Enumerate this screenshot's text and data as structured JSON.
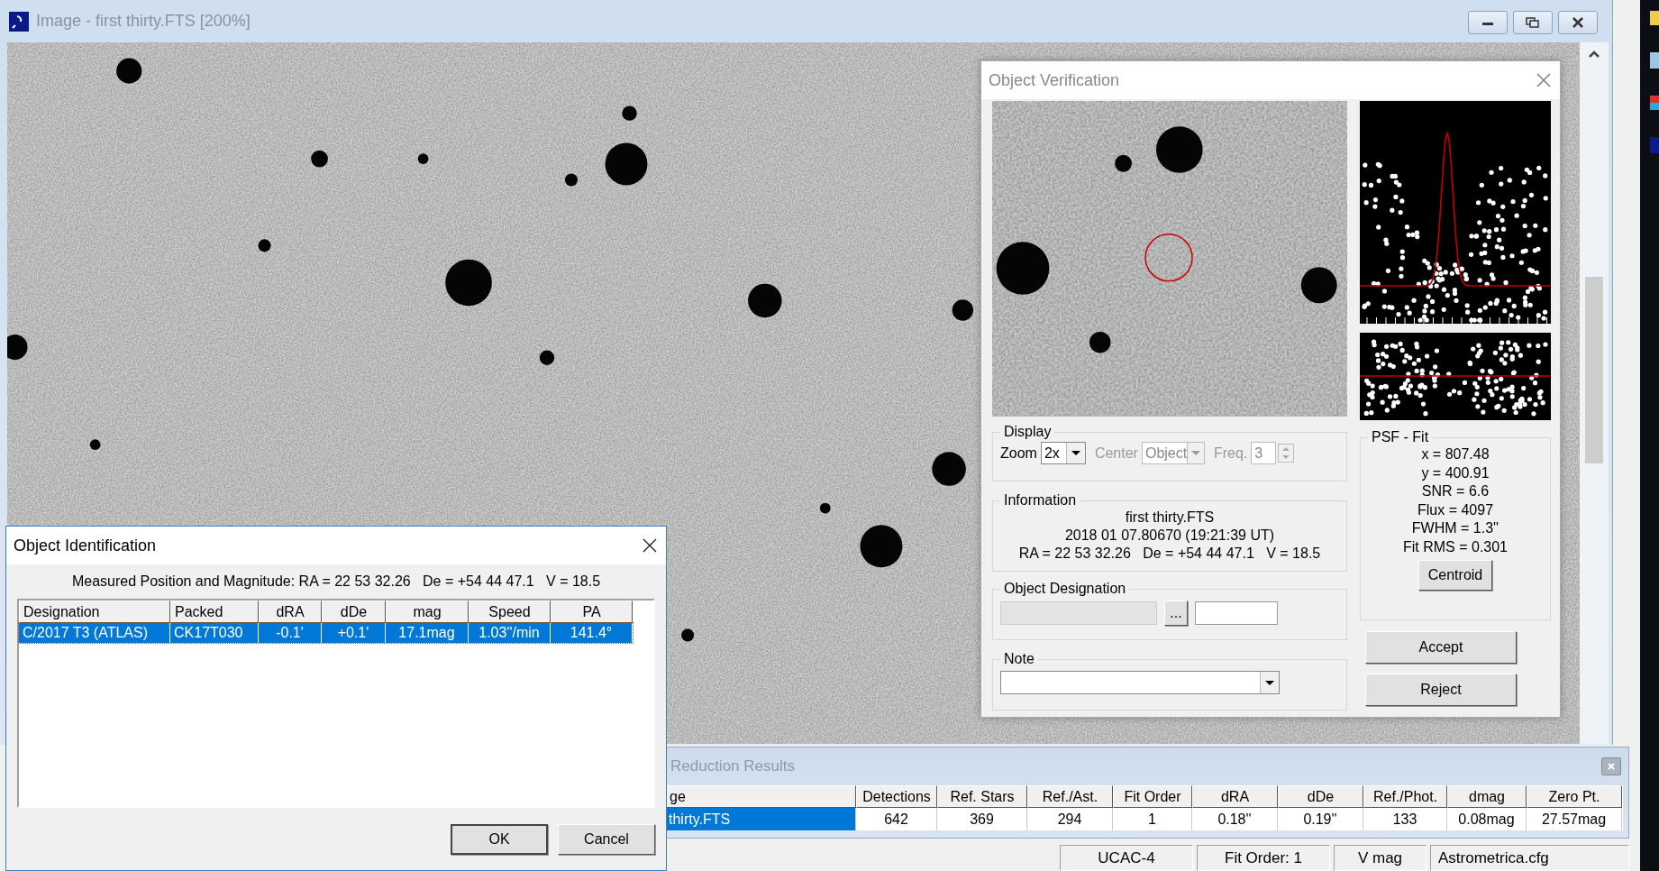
{
  "image_window": {
    "title": "Image - first thirty.FTS [200%]"
  },
  "object_verification": {
    "title": "Object Verification",
    "display": {
      "label": "Display",
      "zoom": {
        "label": "Zoom",
        "value": "2x",
        "disabled": false
      },
      "center": {
        "label": "Center",
        "value": "Object",
        "disabled": true
      },
      "freq": {
        "label": "Freq.",
        "value": "3",
        "disabled": true
      }
    },
    "information": {
      "label": "Information",
      "lines": [
        "first thirty.FTS",
        "2018 01 07.80670 (19:21:39 UT)",
        "RA = 22 53 32.26   De = +54 44 47.1   V = 18.5"
      ]
    },
    "object_designation": {
      "label": "Object Designation",
      "browse_button": "...",
      "fields": [
        {
          "disabled": true
        },
        {
          "disabled": false
        }
      ]
    },
    "note": {
      "label": "Note"
    },
    "psf_fit": {
      "label": "PSF - Fit",
      "lines": [
        "x = 807.48",
        "y = 400.91",
        "SNR = 6.6",
        "Flux = 4097",
        "FWHM = 1.3''",
        "Fit RMS = 0.301"
      ],
      "button": "Centroid"
    },
    "buttons": [
      "Accept",
      "Reject"
    ]
  },
  "object_identification": {
    "title": "Object Identification",
    "measured": "Measured Position and Magnitude: RA = 22 53 32.26   De = +54 44 47.1   V = 18.5",
    "columns": [
      "Designation",
      "Packed",
      "dRA",
      "dDe",
      "mag",
      "Speed",
      "PA"
    ],
    "rows": [
      {
        "cells": [
          "C/2017 T3 (ATLAS)",
          "CK17T030",
          "-0.1'",
          "+0.1'",
          "17.1mag",
          "1.03''/min",
          "141.4°"
        ],
        "selected": true
      }
    ],
    "buttons": [
      "OK",
      "Cancel"
    ]
  },
  "reduction_results": {
    "title": "Reduction Results",
    "columns": [
      "ge",
      "Detections",
      "Ref. Stars",
      "Ref./Ast.",
      "Fit Order",
      "dRA",
      "dDe",
      "Ref./Phot.",
      "dmag",
      "Zero Pt."
    ],
    "rows": [
      {
        "cells": [
          "thirty.FTS",
          "642",
          "369",
          "294",
          "1",
          "0.18''",
          "0.19''",
          "133",
          "0.08mag",
          "27.57mag"
        ],
        "selected": true
      }
    ]
  },
  "status_bar": [
    "UCAC-4",
    "Fit Order: 1",
    "V mag",
    "Astrometrica.cfg"
  ]
}
